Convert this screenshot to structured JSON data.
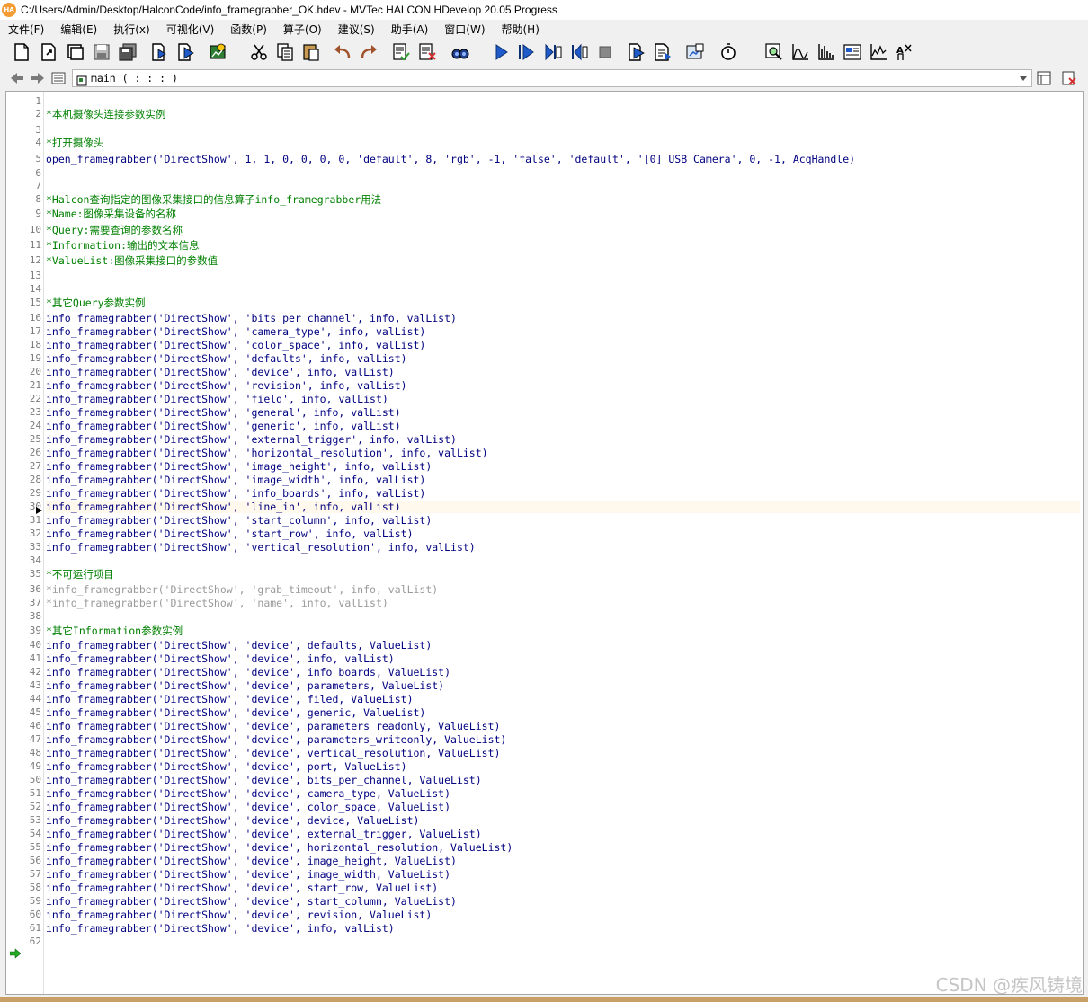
{
  "window": {
    "title": "C:/Users/Admin/Desktop/HalconCode/info_framegrabber_OK.hdev - MVTec HALCON HDevelop 20.05 Progress",
    "app_icon_text": "HA"
  },
  "menu": [
    "文件(F)",
    "编辑(E)",
    "执行(x)",
    "可视化(V)",
    "函数(P)",
    "算子(O)",
    "建议(S)",
    "助手(A)",
    "窗口(W)",
    "帮助(H)"
  ],
  "procedure": {
    "signature": "main ( : : : )"
  },
  "editor": {
    "lines": [
      {
        "n": "1",
        "text": "",
        "kind": "code"
      },
      {
        "n": "2",
        "text": "*本机摄像头连接参数实例",
        "kind": "comment"
      },
      {
        "n": "3",
        "text": "",
        "kind": "code"
      },
      {
        "n": "4",
        "text": "*打开摄像头",
        "kind": "comment"
      },
      {
        "n": "5",
        "text": "open_framegrabber('DirectShow', 1, 1, 0, 0, 0, 0, 'default', 8, 'rgb', -1, 'false', 'default', '[0] USB Camera', 0, -1, AcqHandle)",
        "kind": "code"
      },
      {
        "n": "6",
        "text": "",
        "kind": "code"
      },
      {
        "n": "7",
        "text": "",
        "kind": "code"
      },
      {
        "n": "8",
        "text": "*Halcon查询指定的图像采集接口的信息算子info_framegrabber用法",
        "kind": "comment"
      },
      {
        "n": "9",
        "text": "*Name:图像采集设备的名称",
        "kind": "comment"
      },
      {
        "n": "10",
        "text": "*Query:需要查询的参数名称",
        "kind": "comment"
      },
      {
        "n": "11",
        "text": "*Information:输出的文本信息",
        "kind": "comment"
      },
      {
        "n": "12",
        "text": "*ValueList:图像采集接口的参数值",
        "kind": "comment"
      },
      {
        "n": "13",
        "text": "",
        "kind": "code"
      },
      {
        "n": "14",
        "text": "",
        "kind": "code"
      },
      {
        "n": "15",
        "text": "*其它Query参数实例",
        "kind": "comment"
      },
      {
        "n": "16",
        "text": "info_framegrabber('DirectShow', 'bits_per_channel', info, valList)",
        "kind": "code"
      },
      {
        "n": "17",
        "text": "info_framegrabber('DirectShow', 'camera_type', info, valList)",
        "kind": "code"
      },
      {
        "n": "18",
        "text": "info_framegrabber('DirectShow', 'color_space', info, valList)",
        "kind": "code"
      },
      {
        "n": "19",
        "text": "info_framegrabber('DirectShow', 'defaults', info, valList)",
        "kind": "code"
      },
      {
        "n": "20",
        "text": "info_framegrabber('DirectShow', 'device', info, valList)",
        "kind": "code"
      },
      {
        "n": "21",
        "text": "info_framegrabber('DirectShow', 'revision', info, valList)",
        "kind": "code"
      },
      {
        "n": "22",
        "text": "info_framegrabber('DirectShow', 'field', info, valList)",
        "kind": "code"
      },
      {
        "n": "23",
        "text": "info_framegrabber('DirectShow', 'general', info, valList)",
        "kind": "code"
      },
      {
        "n": "24",
        "text": "info_framegrabber('DirectShow', 'generic', info, valList)",
        "kind": "code"
      },
      {
        "n": "25",
        "text": "info_framegrabber('DirectShow', 'external_trigger', info, valList)",
        "kind": "code"
      },
      {
        "n": "26",
        "text": "info_framegrabber('DirectShow', 'horizontal_resolution', info, valList)",
        "kind": "code"
      },
      {
        "n": "27",
        "text": "info_framegrabber('DirectShow', 'image_height', info, valList)",
        "kind": "code"
      },
      {
        "n": "28",
        "text": "info_framegrabber('DirectShow', 'image_width', info, valList)",
        "kind": "code"
      },
      {
        "n": "29",
        "text": "info_framegrabber('DirectShow', 'info_boards', info, valList)",
        "kind": "code"
      },
      {
        "n": "30",
        "text": "info_framegrabber('DirectShow', 'line_in', info, valList)",
        "kind": "current"
      },
      {
        "n": "31",
        "text": "info_framegrabber('DirectShow', 'start_column', info, valList)",
        "kind": "code"
      },
      {
        "n": "32",
        "text": "info_framegrabber('DirectShow', 'start_row', info, valList)",
        "kind": "code"
      },
      {
        "n": "33",
        "text": "info_framegrabber('DirectShow', 'vertical_resolution', info, valList)",
        "kind": "code"
      },
      {
        "n": "34",
        "text": "",
        "kind": "code"
      },
      {
        "n": "35",
        "text": "*不可运行项目",
        "kind": "comment"
      },
      {
        "n": "36",
        "text": "*info_framegrabber('DirectShow', 'grab_timeout', info, valList)",
        "kind": "disabled"
      },
      {
        "n": "37",
        "text": "*info_framegrabber('DirectShow', 'name', info, valList)",
        "kind": "disabled"
      },
      {
        "n": "38",
        "text": "",
        "kind": "code"
      },
      {
        "n": "39",
        "text": "*其它Information参数实例",
        "kind": "comment"
      },
      {
        "n": "40",
        "text": "info_framegrabber('DirectShow', 'device', defaults, ValueList)",
        "kind": "code"
      },
      {
        "n": "41",
        "text": "info_framegrabber('DirectShow', 'device', info, valList)",
        "kind": "code"
      },
      {
        "n": "42",
        "text": "info_framegrabber('DirectShow', 'device', info_boards, ValueList)",
        "kind": "code"
      },
      {
        "n": "43",
        "text": "info_framegrabber('DirectShow', 'device', parameters, ValueList)",
        "kind": "code"
      },
      {
        "n": "44",
        "text": "info_framegrabber('DirectShow', 'device', filed, ValueList)",
        "kind": "code"
      },
      {
        "n": "45",
        "text": "info_framegrabber('DirectShow', 'device', generic, ValueList)",
        "kind": "code"
      },
      {
        "n": "46",
        "text": "info_framegrabber('DirectShow', 'device', parameters_readonly, ValueList)",
        "kind": "code"
      },
      {
        "n": "47",
        "text": "info_framegrabber('DirectShow', 'device', parameters_writeonly, ValueList)",
        "kind": "code"
      },
      {
        "n": "48",
        "text": "info_framegrabber('DirectShow', 'device', vertical_resolution, ValueList)",
        "kind": "code"
      },
      {
        "n": "49",
        "text": "info_framegrabber('DirectShow', 'device', port, ValueList)",
        "kind": "code"
      },
      {
        "n": "50",
        "text": "info_framegrabber('DirectShow', 'device', bits_per_channel, ValueList)",
        "kind": "code"
      },
      {
        "n": "51",
        "text": "info_framegrabber('DirectShow', 'device', camera_type, ValueList)",
        "kind": "code"
      },
      {
        "n": "52",
        "text": "info_framegrabber('DirectShow', 'device', color_space, ValueList)",
        "kind": "code"
      },
      {
        "n": "53",
        "text": "info_framegrabber('DirectShow', 'device', device, ValueList)",
        "kind": "code"
      },
      {
        "n": "54",
        "text": "info_framegrabber('DirectShow', 'device', external_trigger, ValueList)",
        "kind": "code"
      },
      {
        "n": "55",
        "text": "info_framegrabber('DirectShow', 'device', horizontal_resolution, ValueList)",
        "kind": "code"
      },
      {
        "n": "56",
        "text": "info_framegrabber('DirectShow', 'device', image_height, ValueList)",
        "kind": "code"
      },
      {
        "n": "57",
        "text": "info_framegrabber('DirectShow', 'device', image_width, ValueList)",
        "kind": "code"
      },
      {
        "n": "58",
        "text": "info_framegrabber('DirectShow', 'device', start_row, ValueList)",
        "kind": "code"
      },
      {
        "n": "59",
        "text": "info_framegrabber('DirectShow', 'device', start_column, ValueList)",
        "kind": "code"
      },
      {
        "n": "60",
        "text": "info_framegrabber('DirectShow', 'device', revision, ValueList)",
        "kind": "code"
      },
      {
        "n": "61",
        "text": "info_framegrabber('DirectShow', 'device', info, valList)",
        "kind": "code"
      },
      {
        "n": "62",
        "text": "",
        "kind": "code"
      }
    ]
  },
  "watermark": "CSDN @疾风铸境",
  "colors": {
    "code": "#000080",
    "comment": "#008000",
    "disabled": "#9a9a9a",
    "line_number": "#7a7a7a"
  }
}
